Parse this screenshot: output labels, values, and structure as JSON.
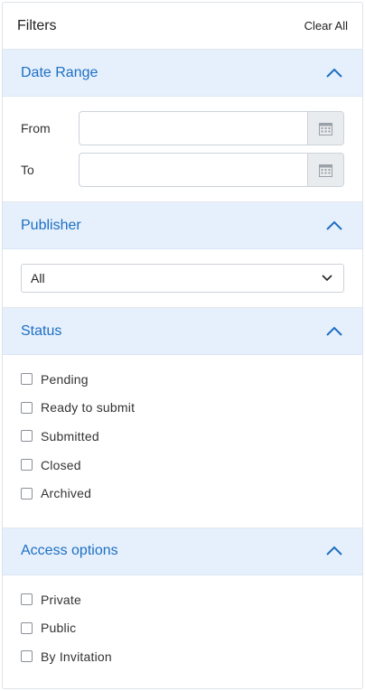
{
  "header": {
    "title": "Filters",
    "clear_label": "Clear All"
  },
  "date_range": {
    "title": "Date Range",
    "from_label": "From",
    "from_value": "",
    "to_label": "To",
    "to_value": ""
  },
  "publisher": {
    "title": "Publisher",
    "selected": "All"
  },
  "status": {
    "title": "Status",
    "options": [
      {
        "label": "Pending",
        "checked": false
      },
      {
        "label": "Ready to submit",
        "checked": false
      },
      {
        "label": "Submitted",
        "checked": false
      },
      {
        "label": "Closed",
        "checked": false
      },
      {
        "label": "Archived",
        "checked": false
      }
    ]
  },
  "access": {
    "title": "Access options",
    "options": [
      {
        "label": "Private",
        "checked": false
      },
      {
        "label": "Public",
        "checked": false
      },
      {
        "label": "By Invitation",
        "checked": false
      }
    ]
  },
  "colors": {
    "accent": "#1d6fc2",
    "section_bg": "#e6f0fd"
  },
  "icons": {
    "section_toggle": "chevron-up-icon",
    "date_button": "calendar-icon",
    "select_toggle": "chevron-down-icon"
  }
}
